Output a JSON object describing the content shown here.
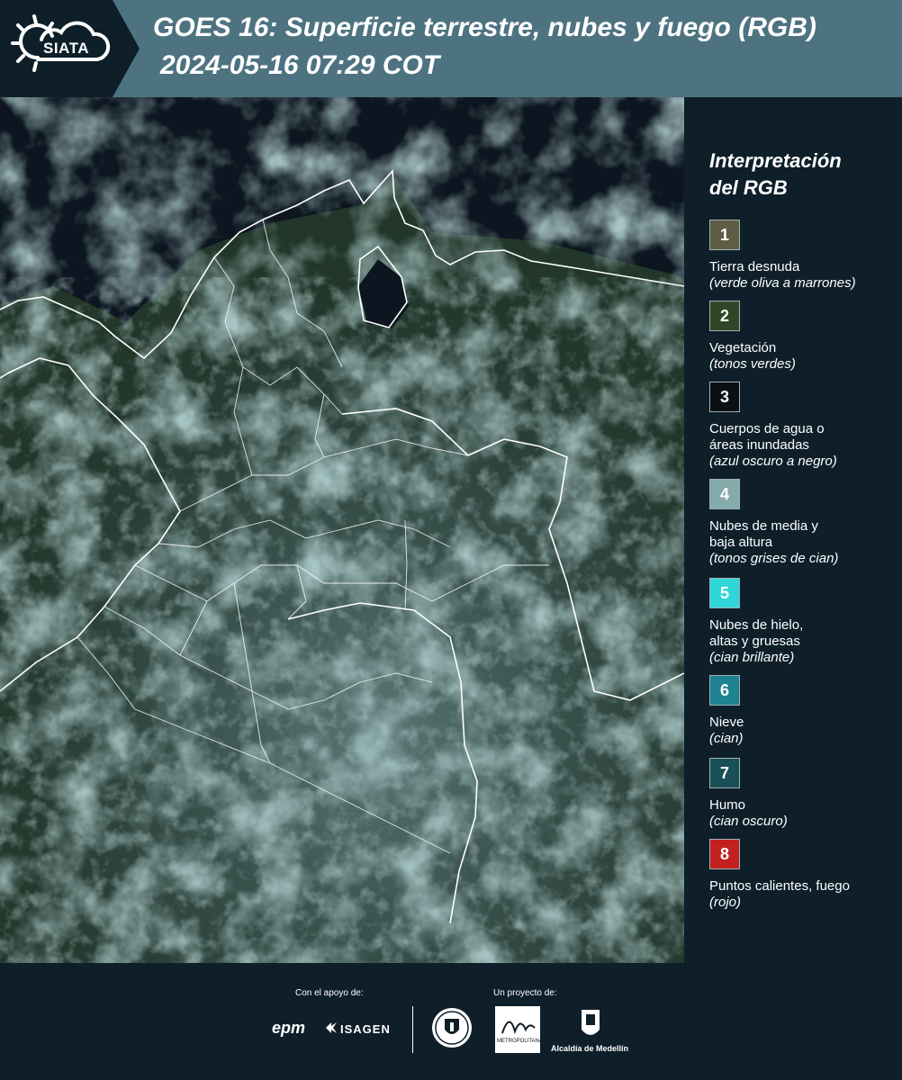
{
  "header": {
    "logo_text": "SIATA",
    "title": "GOES 16: Superficie terrestre, nubes y fuego (RGB)",
    "subtitle": "2024-05-16 07:29 COT"
  },
  "legend": {
    "title_line1": "Interpretación",
    "title_line2": "del RGB",
    "items": [
      {
        "number": "1",
        "label": "Tierra desnuda",
        "note": "(verde oliva a marrones)",
        "color": "#5f5d44"
      },
      {
        "number": "2",
        "label": "Vegetación",
        "note": "(tonos verdes)",
        "color": "#2f4727"
      },
      {
        "number": "3",
        "label": "Cuerpos de agua o áreas inundadas",
        "note": "(azul oscuro a negro)",
        "color": "#0c1013"
      },
      {
        "number": "4",
        "label": "Nubes de media y baja altura",
        "note": "(tonos grises de cian)",
        "color": "#84aaa9"
      },
      {
        "number": "5",
        "label": "Nubes de hielo, altas y gruesas",
        "note": "(cian brillante)",
        "color": "#2fd6d9"
      },
      {
        "number": "6",
        "label": "Nieve",
        "note": "(cian)",
        "color": "#1e8290"
      },
      {
        "number": "7",
        "label": "Humo",
        "note": "(cian oscuro)",
        "color": "#1b4f57"
      },
      {
        "number": "8",
        "label": "Puntos calientes, fuego",
        "note": "(rojo)",
        "color": "#c3211f"
      }
    ]
  },
  "footer": {
    "support_label": "Con el apoyo de:",
    "project_label": "Un proyecto de:",
    "epm_logo_text": "epm",
    "isagen_logo_text": "ISAGEN",
    "metro_logo_text": "METROPOLITANA",
    "alcaldia_text": "Alcaldía de Medellín"
  }
}
